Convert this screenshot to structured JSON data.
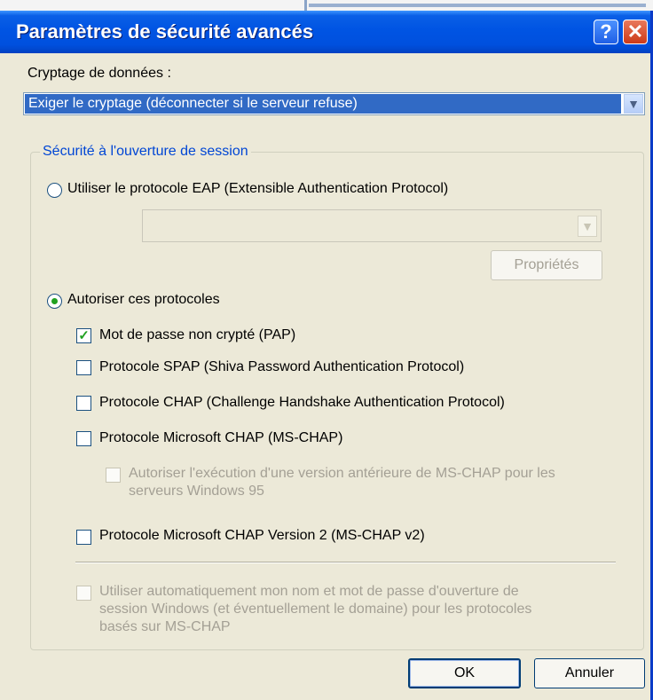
{
  "window": {
    "title": "Paramètres de sécurité avancés",
    "help_glyph": "?",
    "close_glyph": "✕"
  },
  "encryption": {
    "label": "Cryptage de données :",
    "selected": "Exiger le cryptage (déconnecter si le serveur refuse)"
  },
  "logon_security": {
    "legend": "Sécurité à l'ouverture de session",
    "eap_radio": {
      "label": "Utiliser le protocole EAP (Extensible Authentication Protocol)",
      "checked": false
    },
    "eap_dropdown_value": "",
    "properties_button": "Propriétés",
    "allow_radio": {
      "label": "Autoriser ces protocoles",
      "checked": true
    },
    "protocols": [
      {
        "label": "Mot de passe non crypté (PAP)",
        "checked": true
      },
      {
        "label": "Protocole SPAP (Shiva Password Authentication Protocol)",
        "checked": false
      },
      {
        "label": "Protocole CHAP (Challenge Handshake Authentication Protocol)",
        "checked": false
      },
      {
        "label": "Protocole Microsoft CHAP (MS-CHAP)",
        "checked": false
      }
    ],
    "mschap_legacy": {
      "line1": "Autoriser l'exécution d'une version antérieure de MS-CHAP pour les",
      "line2": "serveurs Windows 95",
      "checked": false
    },
    "mschap_v2": {
      "label": "Protocole Microsoft CHAP Version 2 (MS-CHAP v2)",
      "checked": false
    },
    "auto_logon": {
      "line1": "Utiliser automatiquement mon nom et mot de passe d'ouverture de",
      "line2": "session Windows (et éventuellement le domaine) pour les protocoles",
      "line3": "basés sur MS-CHAP",
      "checked": false
    }
  },
  "buttons": {
    "ok": "OK",
    "cancel": "Annuler"
  },
  "colors": {
    "title_blue": "#0054e3",
    "legend_blue": "#0046d5",
    "selection": "#316ac5",
    "check_green": "#21a121"
  }
}
